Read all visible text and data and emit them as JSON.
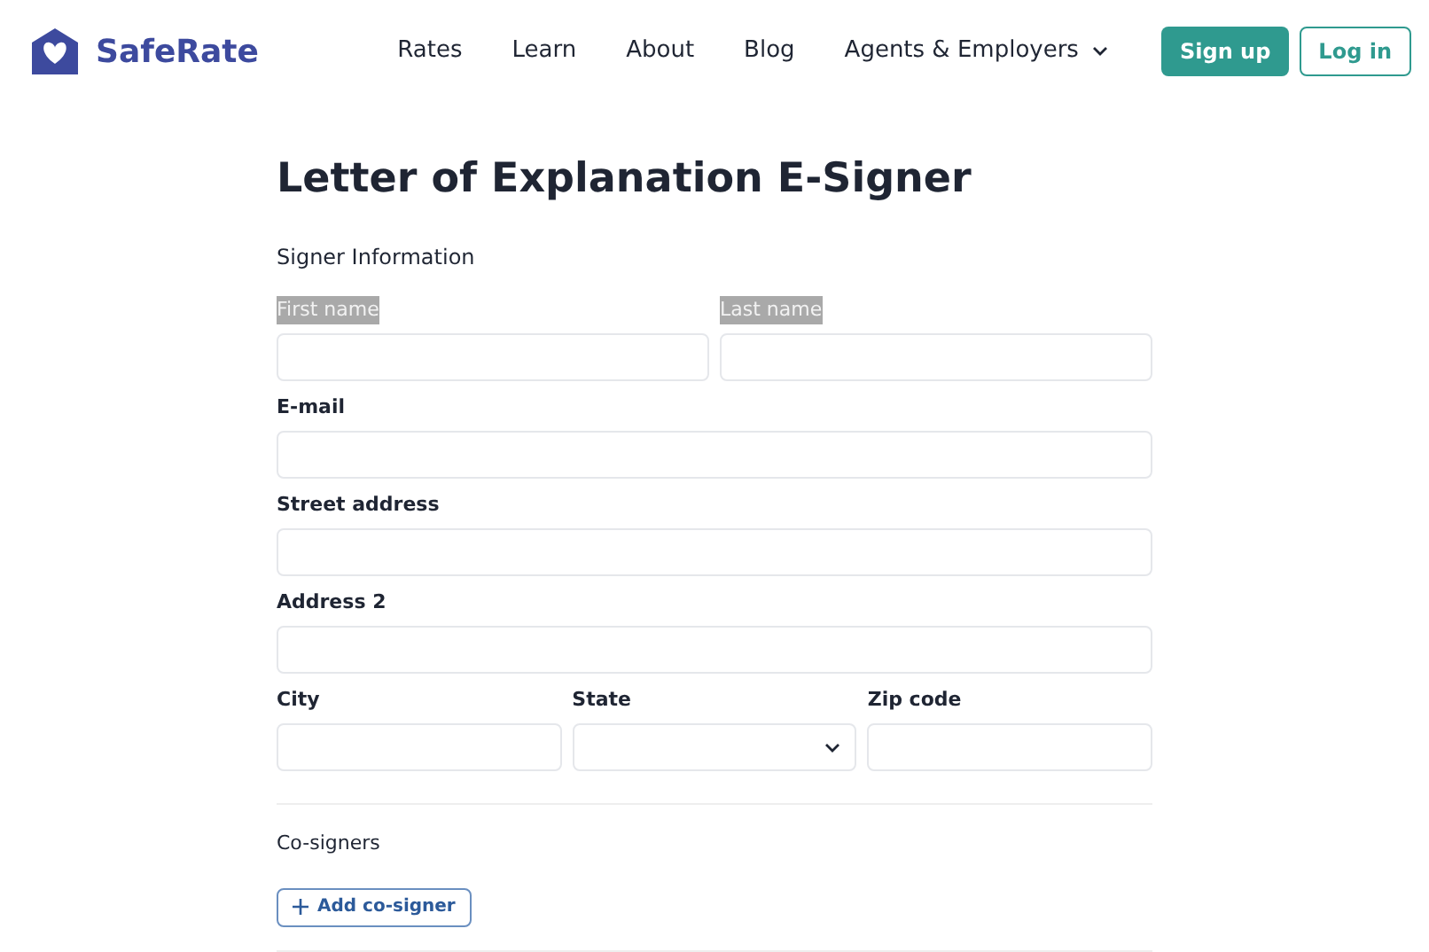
{
  "header": {
    "logo": "SafeRate",
    "nav": [
      {
        "label": "Rates",
        "kind": "link"
      },
      {
        "label": "Learn",
        "kind": "link"
      },
      {
        "label": "About",
        "kind": "link"
      },
      {
        "label": "Blog",
        "kind": "link"
      },
      {
        "label": "Agents & Employers",
        "kind": "dropdown"
      }
    ],
    "buttons": [
      {
        "label": "Sign up",
        "kind": "primary"
      },
      {
        "label": "Log in",
        "kind": "outline"
      }
    ]
  },
  "title": "Letter of Explanation E-Signer",
  "section": "Signer Information",
  "rows": [
    [
      {
        "label": "First name",
        "highlighted": true,
        "kind": "text"
      },
      {
        "label": "Last name",
        "highlighted": true,
        "kind": "text"
      }
    ],
    [
      {
        "label": "E-mail",
        "highlighted": false,
        "kind": "text"
      }
    ],
    [
      {
        "label": "Street address",
        "highlighted": false,
        "kind": "text"
      }
    ],
    [
      {
        "label": "Address 2",
        "highlighted": false,
        "kind": "text"
      }
    ],
    [
      {
        "label": "City",
        "highlighted": false,
        "kind": "text"
      },
      {
        "label": "State",
        "highlighted": false,
        "kind": "select"
      },
      {
        "label": "Zip code",
        "highlighted": false,
        "kind": "text"
      }
    ]
  ],
  "cosigners": {
    "heading": "Co-signers",
    "button": "Add co-signer"
  }
}
